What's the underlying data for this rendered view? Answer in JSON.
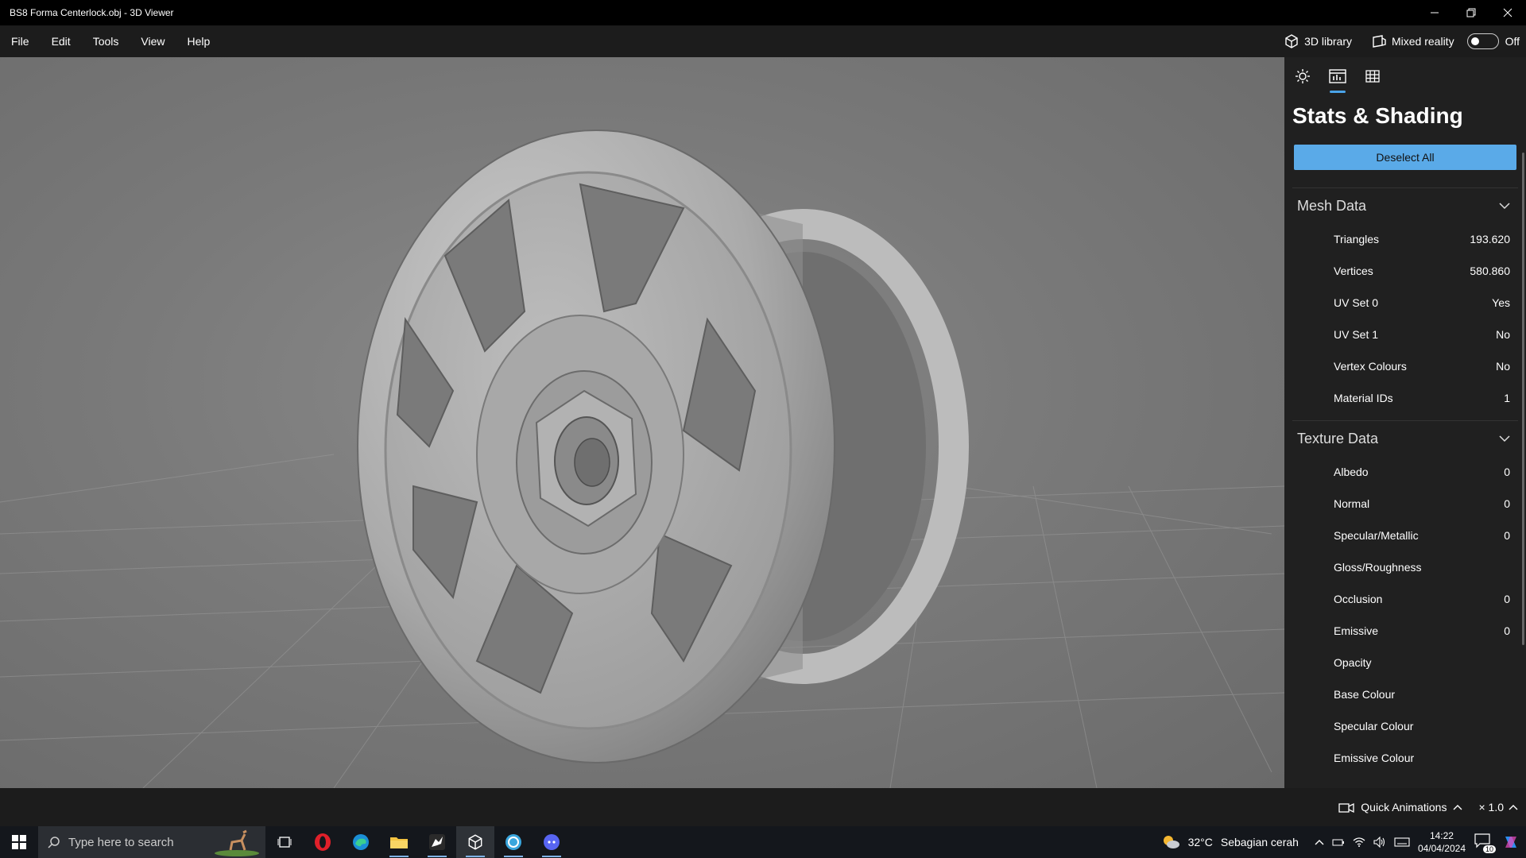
{
  "window": {
    "title": "BS8 Forma Centerlock.obj - 3D Viewer",
    "minimize_icon": "minimize-icon",
    "restore_icon": "restore-icon",
    "close_icon": "close-icon"
  },
  "menubar": {
    "items": [
      "File",
      "Edit",
      "Tools",
      "View",
      "Help"
    ],
    "library_label": "3D library",
    "mixed_reality_label": "Mixed reality",
    "mixed_reality_state": "Off"
  },
  "panel": {
    "title": "Stats & Shading",
    "deselect_label": "Deselect All",
    "tabs": [
      "lighting-icon",
      "stats-icon",
      "grid-icon"
    ],
    "active_tab": 1,
    "mesh_section": "Mesh Data",
    "mesh_rows": [
      {
        "label": "Triangles",
        "value": "193.620"
      },
      {
        "label": "Vertices",
        "value": "580.860"
      },
      {
        "label": "UV Set 0",
        "value": "Yes"
      },
      {
        "label": "UV Set 1",
        "value": "No"
      },
      {
        "label": "Vertex Colours",
        "value": "No"
      },
      {
        "label": "Material IDs",
        "value": "1"
      }
    ],
    "texture_section": "Texture Data",
    "texture_rows": [
      {
        "label": "Albedo",
        "value": "0"
      },
      {
        "label": "Normal",
        "value": "0"
      },
      {
        "label": "Specular/Metallic",
        "value": "0"
      },
      {
        "label": "Gloss/Roughness",
        "value": ""
      },
      {
        "label": "Occlusion",
        "value": "0"
      },
      {
        "label": "Emissive",
        "value": "0"
      },
      {
        "label": "Opacity",
        "value": ""
      },
      {
        "label": "Base Colour",
        "value": ""
      },
      {
        "label": "Specular Colour",
        "value": ""
      },
      {
        "label": "Emissive Colour",
        "value": ""
      }
    ]
  },
  "status": {
    "quick_animations": "Quick Animations",
    "speed": "× 1.0"
  },
  "taskbar": {
    "search_placeholder": "Type here to search",
    "weather_temp": "32°C",
    "weather_desc": "Sebagian cerah",
    "time": "14:22",
    "date": "04/04/2024",
    "notification_count": "10"
  },
  "colors": {
    "accent": "#5aaae8",
    "panel_bg": "#202020",
    "menubar_bg": "#1c1c1c"
  }
}
